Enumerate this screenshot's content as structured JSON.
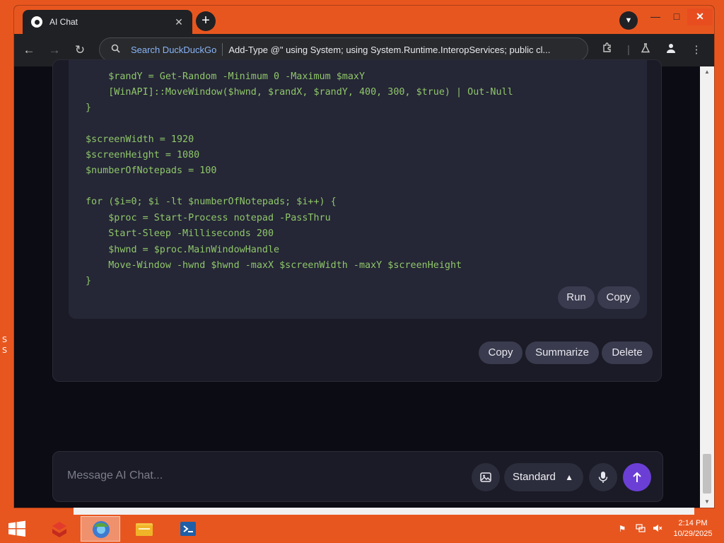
{
  "desktop": {
    "edge_letters": [
      "S",
      "S"
    ]
  },
  "browser": {
    "tab": {
      "title": "AI Chat",
      "close_glyph": "✕"
    },
    "new_tab_glyph": "+",
    "window_controls": {
      "minimize": "—",
      "maximize": "□",
      "close": "✕"
    },
    "omnibox": {
      "engine_label": "Search DuckDuckGo",
      "query": "Add-Type @\" using System; using System.Runtime.InteropServices; public cl..."
    }
  },
  "chat": {
    "code_lines": [
      "    $randY = Get-Random -Minimum 0 -Maximum $maxY",
      "    [WinAPI]::MoveWindow($hwnd, $randX, $randY, 400, 300, $true) | Out-Null",
      "}",
      "",
      "$screenWidth = 1920",
      "$screenHeight = 1080",
      "$numberOfNotepads = 100",
      "",
      "for ($i=0; $i -lt $numberOfNotepads; $i++) {",
      "    $proc = Start-Process notepad -PassThru",
      "    Start-Sleep -Milliseconds 200",
      "    $hwnd = $proc.MainWindowHandle",
      "    Move-Window -hwnd $hwnd -maxX $screenWidth -maxY $screenHeight",
      "}"
    ],
    "code_actions": {
      "run": "Run",
      "copy": "Copy"
    },
    "message_actions": {
      "copy": "Copy",
      "summarize": "Summarize",
      "delete": "Delete"
    },
    "composer": {
      "placeholder": "Message AI Chat...",
      "mode": "Standard"
    }
  },
  "taskbar": {
    "clock_time": "2:14 PM",
    "clock_date": "10/29/2025"
  }
}
